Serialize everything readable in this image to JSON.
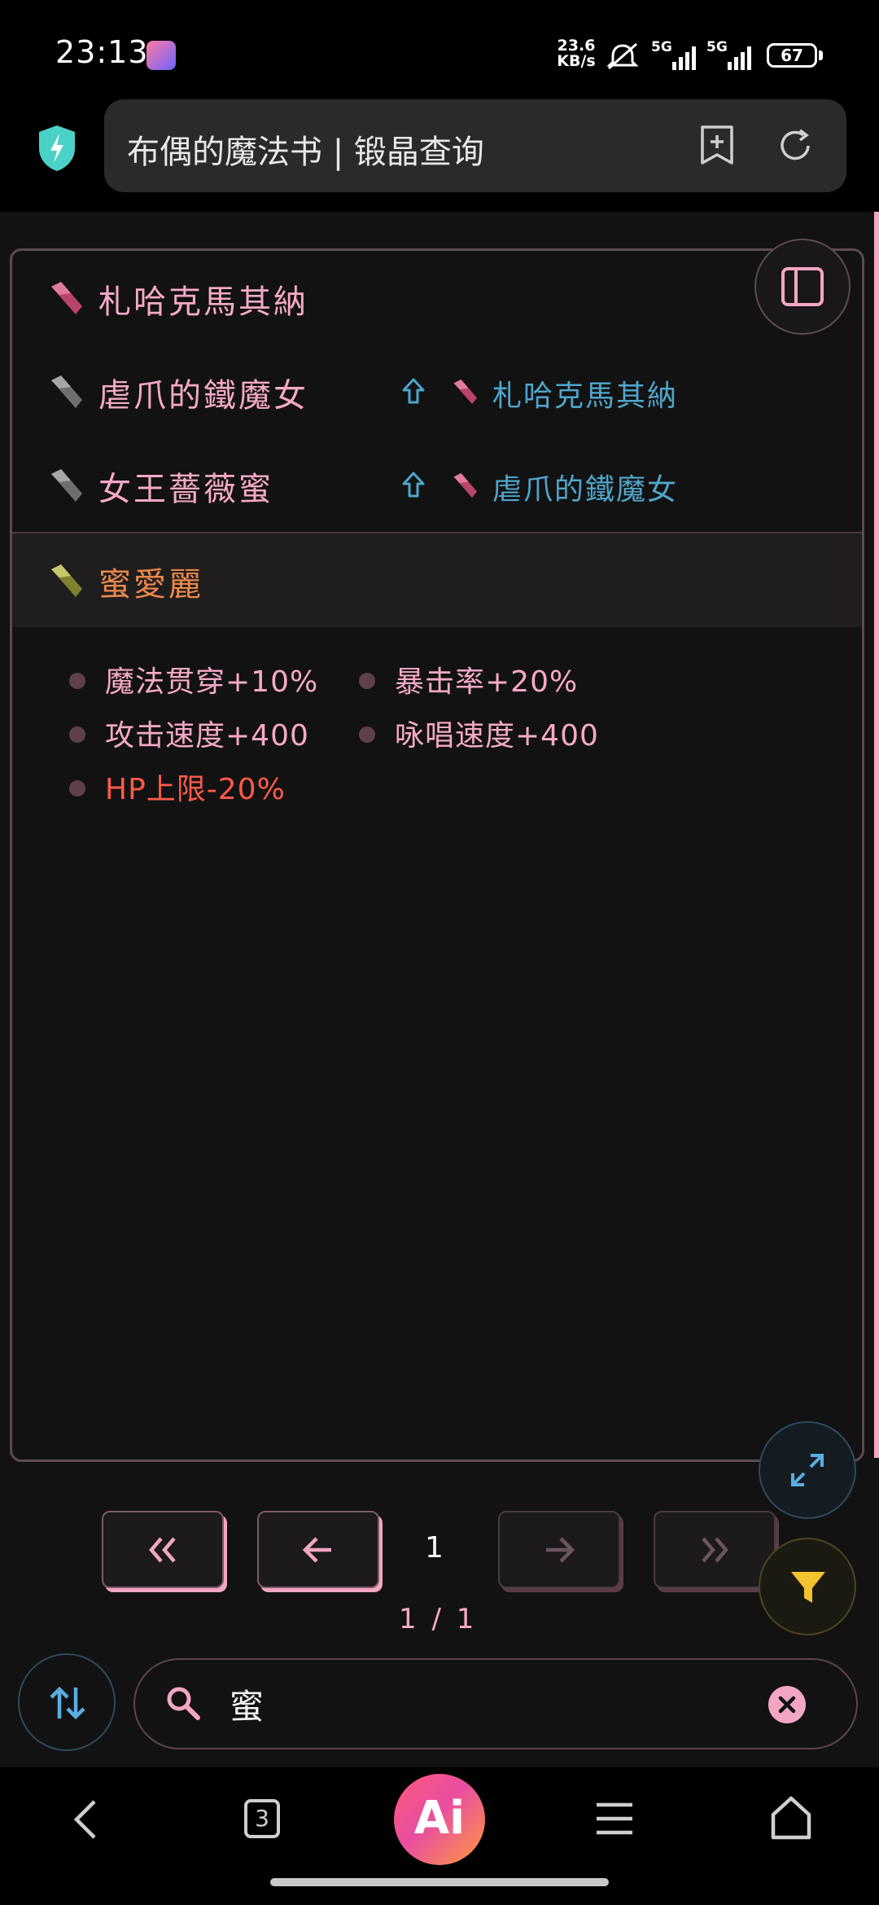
{
  "status_bar": {
    "time": "23:13",
    "speed_value": "23.6",
    "speed_unit": "KB/s",
    "network_1": "5G",
    "network_2": "5G",
    "battery": "67"
  },
  "browser": {
    "title": "布偶的魔法书 | 锻晶查询"
  },
  "results": {
    "rows": [
      {
        "name": "札哈克馬其納",
        "gem_color": "#c0506f",
        "upgrade_from": ""
      },
      {
        "name": "虐爪的鐵魔女",
        "gem_color": "#8a8a8a",
        "upgrade_from": "札哈克馬其納"
      },
      {
        "name": "女王薔薇蜜",
        "gem_color": "#8a8a8a",
        "upgrade_from": "虐爪的鐵魔女"
      }
    ],
    "selected": {
      "name": "蜜愛麗",
      "gem_color": "#9aa04a",
      "stats": [
        {
          "text": "魔法贯穿+10%",
          "color": "#f6a9c7"
        },
        {
          "text": "暴击率+20%",
          "color": "#f6a9c7"
        },
        {
          "text": "攻击速度+400",
          "color": "#f6a9c7"
        },
        {
          "text": "咏唱速度+400",
          "color": "#f6a9c7"
        },
        {
          "text": "HP上限-20%",
          "color": "#ff5a4a"
        }
      ]
    }
  },
  "pagination": {
    "first_icon": "double-chevron-left-icon",
    "prev_icon": "arrow-left-icon",
    "current": "1",
    "next_icon": "arrow-right-icon",
    "last_icon": "double-chevron-right-icon",
    "count": "1 / 1"
  },
  "search": {
    "value": "蜜"
  },
  "nav_bar": {
    "tabs_count": "3",
    "ai_label": "Ai"
  },
  "colors": {
    "accent_pink": "#f6a9c7",
    "upgrade_blue": "#4fa6cc",
    "selected_orange": "#e9874a",
    "negative_red": "#ff5a4a",
    "filter_yellow": "#f2c230"
  }
}
